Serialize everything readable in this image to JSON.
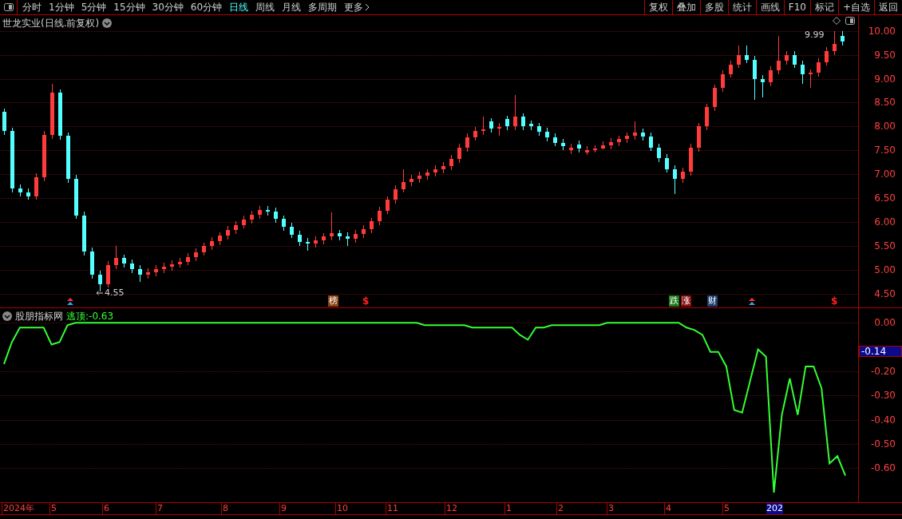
{
  "toolbar": {
    "periods": [
      {
        "label": "分时",
        "selected": false
      },
      {
        "label": "1分钟",
        "selected": false
      },
      {
        "label": "5分钟",
        "selected": false
      },
      {
        "label": "15分钟",
        "selected": false
      },
      {
        "label": "30分钟",
        "selected": false
      },
      {
        "label": "60分钟",
        "selected": false
      },
      {
        "label": "日线",
        "selected": true
      },
      {
        "label": "周线",
        "selected": false
      },
      {
        "label": "月线",
        "selected": false
      },
      {
        "label": "多周期",
        "selected": false
      }
    ],
    "more": "更多",
    "actions": [
      "复权",
      "叠加",
      "多股",
      "统计",
      "画线",
      "F10",
      "标记",
      "+自选",
      "返回"
    ]
  },
  "price_chart": {
    "title": "世龙实业(日线.前复权)",
    "high_label": "9.99",
    "low_label": "4.55",
    "markers": [
      {
        "kind": "arrow"
      },
      {
        "kind": "tag",
        "label": "榜",
        "color": "#8b4513"
      },
      {
        "kind": "dollar",
        "label": "$"
      },
      {
        "kind": "tag",
        "label": "跌",
        "color": "#1a7a1a"
      },
      {
        "kind": "tag",
        "label": "涨",
        "color": "#8b1010"
      },
      {
        "kind": "tag",
        "label": "财",
        "color": "#1c3f6e"
      },
      {
        "kind": "arrow"
      },
      {
        "kind": "dollar",
        "label": "$"
      }
    ],
    "chart_data": {
      "type": "candlestick",
      "categories": [
        null,
        null,
        null,
        null,
        null,
        null,
        null,
        null,
        null,
        null,
        null,
        null,
        null,
        null,
        null,
        null,
        null,
        null,
        null,
        null,
        null,
        null,
        null,
        null,
        null,
        null,
        null,
        null,
        null,
        null,
        null,
        null,
        null,
        null,
        null,
        null,
        null,
        null,
        null,
        null,
        null,
        null,
        null,
        null,
        null,
        null,
        null,
        null,
        null,
        null,
        null,
        null,
        null,
        null,
        null,
        null,
        null,
        null,
        null,
        null,
        null,
        null,
        null,
        null,
        null,
        null,
        null,
        null,
        null,
        null,
        null,
        null,
        null,
        null,
        null,
        null,
        null,
        null,
        null,
        null,
        null,
        null,
        null,
        null,
        null,
        null,
        null,
        null,
        null,
        null,
        null,
        null,
        null,
        null,
        null,
        null,
        null,
        null,
        null,
        null,
        null,
        null,
        null,
        null,
        null,
        null
      ],
      "ohlc": [
        [
          8.3,
          8.38,
          7.82,
          7.9
        ],
        [
          7.9,
          7.98,
          6.62,
          6.7
        ],
        [
          6.7,
          6.78,
          6.54,
          6.62
        ],
        [
          6.62,
          6.7,
          6.46,
          6.54
        ],
        [
          6.54,
          7.02,
          6.46,
          6.94
        ],
        [
          6.94,
          7.9,
          6.86,
          7.82
        ],
        [
          7.82,
          8.9,
          7.74,
          8.7
        ],
        [
          8.7,
          8.78,
          7.72,
          7.8
        ],
        [
          7.8,
          7.88,
          6.82,
          6.9
        ],
        [
          6.9,
          6.98,
          6.06,
          6.14
        ],
        [
          6.14,
          6.22,
          5.3,
          5.38
        ],
        [
          5.38,
          5.46,
          4.82,
          4.9
        ],
        [
          4.9,
          4.98,
          4.55,
          4.7
        ],
        [
          4.7,
          5.18,
          4.62,
          5.1
        ],
        [
          5.1,
          5.5,
          5.02,
          5.24
        ],
        [
          5.24,
          5.32,
          5.05,
          5.13
        ],
        [
          5.13,
          5.21,
          4.93,
          5.01
        ],
        [
          5.01,
          5.09,
          4.75,
          4.9
        ],
        [
          4.9,
          5.03,
          4.82,
          4.95
        ],
        [
          4.95,
          5.09,
          4.87,
          5.01
        ],
        [
          5.01,
          5.14,
          4.93,
          5.06
        ],
        [
          5.06,
          5.2,
          4.98,
          5.12
        ],
        [
          5.12,
          5.25,
          5.04,
          5.17
        ],
        [
          5.17,
          5.34,
          5.09,
          5.26
        ],
        [
          5.26,
          5.45,
          5.18,
          5.37
        ],
        [
          5.37,
          5.57,
          5.29,
          5.49
        ],
        [
          5.49,
          5.68,
          5.41,
          5.6
        ],
        [
          5.6,
          5.79,
          5.52,
          5.71
        ],
        [
          5.71,
          5.91,
          5.63,
          5.83
        ],
        [
          5.83,
          6.02,
          5.75,
          5.94
        ],
        [
          5.94,
          6.13,
          5.86,
          6.05
        ],
        [
          6.05,
          6.23,
          5.97,
          6.15
        ],
        [
          6.15,
          6.33,
          6.07,
          6.25
        ],
        [
          6.25,
          6.33,
          6.14,
          6.22
        ],
        [
          6.22,
          6.3,
          5.98,
          6.06
        ],
        [
          6.06,
          6.14,
          5.82,
          5.9
        ],
        [
          5.9,
          5.98,
          5.66,
          5.74
        ],
        [
          5.74,
          5.82,
          5.5,
          5.58
        ],
        [
          5.58,
          5.66,
          5.4,
          5.54
        ],
        [
          5.54,
          5.69,
          5.46,
          5.61
        ],
        [
          5.61,
          5.77,
          5.53,
          5.69
        ],
        [
          5.69,
          6.2,
          5.61,
          5.76
        ],
        [
          5.76,
          5.84,
          5.62,
          5.7
        ],
        [
          5.7,
          5.78,
          5.5,
          5.65
        ],
        [
          5.65,
          5.83,
          5.57,
          5.75
        ],
        [
          5.75,
          5.93,
          5.67,
          5.85
        ],
        [
          5.85,
          6.09,
          5.77,
          6.01
        ],
        [
          6.01,
          6.32,
          5.93,
          6.24
        ],
        [
          6.24,
          6.54,
          6.16,
          6.46
        ],
        [
          6.46,
          6.77,
          6.38,
          6.69
        ],
        [
          6.69,
          7.1,
          6.61,
          6.83
        ],
        [
          6.83,
          6.98,
          6.75,
          6.9
        ],
        [
          6.9,
          7.05,
          6.82,
          6.97
        ],
        [
          6.97,
          7.11,
          6.89,
          7.03
        ],
        [
          7.03,
          7.18,
          6.95,
          7.1
        ],
        [
          7.1,
          7.25,
          7.02,
          7.17
        ],
        [
          7.17,
          7.4,
          7.09,
          7.32
        ],
        [
          7.32,
          7.63,
          7.24,
          7.55
        ],
        [
          7.55,
          7.86,
          7.47,
          7.78
        ],
        [
          7.78,
          7.99,
          7.7,
          7.91
        ],
        [
          7.91,
          8.2,
          7.83,
          7.94
        ],
        [
          8.1,
          8.18,
          7.88,
          7.96
        ],
        [
          7.96,
          8.07,
          7.8,
          7.99
        ],
        [
          8.15,
          8.23,
          7.92,
          8.0
        ],
        [
          8.0,
          8.65,
          7.92,
          8.2
        ],
        [
          8.2,
          8.28,
          7.92,
          8.0
        ],
        [
          8.05,
          8.13,
          7.92,
          8.0
        ],
        [
          8.0,
          8.08,
          7.81,
          7.89
        ],
        [
          7.89,
          7.97,
          7.69,
          7.77
        ],
        [
          7.77,
          7.85,
          7.58,
          7.66
        ],
        [
          7.66,
          7.74,
          7.51,
          7.59
        ],
        [
          7.5,
          7.64,
          7.42,
          7.56
        ],
        [
          7.62,
          7.7,
          7.46,
          7.54
        ],
        [
          7.45,
          7.59,
          7.4,
          7.51
        ],
        [
          7.51,
          7.61,
          7.45,
          7.53
        ],
        [
          7.53,
          7.68,
          7.52,
          7.6
        ],
        [
          7.6,
          7.75,
          7.52,
          7.67
        ],
        [
          7.67,
          7.81,
          7.59,
          7.73
        ],
        [
          7.73,
          7.88,
          7.65,
          7.8
        ],
        [
          7.8,
          8.1,
          7.72,
          7.87
        ],
        [
          7.87,
          7.95,
          7.71,
          7.79
        ],
        [
          7.79,
          7.87,
          7.48,
          7.56
        ],
        [
          7.56,
          7.64,
          7.26,
          7.34
        ],
        [
          7.34,
          7.42,
          7.03,
          7.11
        ],
        [
          7.11,
          7.19,
          6.58,
          6.9
        ],
        [
          6.9,
          7.13,
          6.82,
          7.05
        ],
        [
          7.05,
          7.63,
          6.97,
          7.55
        ],
        [
          7.55,
          8.08,
          7.47,
          8.0
        ],
        [
          8.0,
          8.48,
          7.92,
          8.4
        ],
        [
          8.4,
          8.88,
          8.32,
          8.8
        ],
        [
          8.8,
          9.18,
          8.72,
          9.1
        ],
        [
          9.1,
          9.38,
          9.02,
          9.3
        ],
        [
          9.3,
          9.7,
          9.22,
          9.5
        ],
        [
          9.5,
          9.7,
          9.32,
          9.4
        ],
        [
          9.4,
          9.48,
          8.55,
          9.0
        ],
        [
          9.0,
          9.08,
          8.6,
          8.93
        ],
        [
          8.93,
          9.26,
          8.85,
          9.18
        ],
        [
          9.18,
          9.9,
          9.1,
          9.37
        ],
        [
          9.37,
          9.58,
          9.29,
          9.5
        ],
        [
          9.5,
          9.58,
          9.22,
          9.3
        ],
        [
          9.3,
          9.38,
          8.9,
          9.1
        ],
        [
          9.1,
          9.2,
          8.8,
          9.12
        ],
        [
          9.12,
          9.43,
          9.04,
          9.35
        ],
        [
          9.35,
          9.66,
          9.27,
          9.58
        ],
        [
          9.58,
          9.99,
          9.5,
          9.72
        ],
        [
          9.9,
          9.99,
          9.7,
          9.77
        ]
      ],
      "ylim": [
        4.21,
        10.33
      ],
      "grid": true,
      "yticks": [
        {
          "value": 10,
          "label": "10.00"
        },
        {
          "value": 9.5,
          "label": "9.50"
        },
        {
          "value": 9,
          "label": "9.00"
        },
        {
          "value": 8.5,
          "label": "8.50"
        },
        {
          "value": 8,
          "label": "8.00"
        },
        {
          "value": 7.5,
          "label": "7.50"
        },
        {
          "value": 7,
          "label": "7.00"
        },
        {
          "value": 6.5,
          "label": "6.50"
        },
        {
          "value": 6,
          "label": "6.00"
        },
        {
          "value": 5.5,
          "label": "5.50"
        },
        {
          "value": 5,
          "label": "5.00"
        },
        {
          "value": 4.5,
          "label": "4.50"
        }
      ]
    }
  },
  "indicator": {
    "name": "股朋指标网",
    "series_value": "-0.63",
    "current_value": "-0.14",
    "chart_data": {
      "type": "line",
      "categories": [
        null,
        null,
        null,
        null,
        null,
        null,
        null,
        null,
        null,
        null,
        null,
        null,
        null,
        null,
        null,
        null,
        null,
        null,
        null,
        null,
        null,
        null,
        null,
        null,
        null,
        null,
        null,
        null,
        null,
        null,
        null,
        null,
        null,
        null,
        null,
        null,
        null,
        null,
        null,
        null,
        null,
        null,
        null,
        null,
        null,
        null,
        null,
        null,
        null,
        null,
        null,
        null,
        null,
        null,
        null,
        null,
        null,
        null,
        null,
        null,
        null,
        null,
        null,
        null,
        null,
        null,
        null,
        null,
        null,
        null,
        null,
        null,
        null,
        null,
        null,
        null,
        null,
        null,
        null,
        null,
        null,
        null,
        null,
        null,
        null,
        null,
        null,
        null,
        null,
        null,
        null,
        null,
        null,
        null,
        null,
        null,
        null,
        null,
        null,
        null,
        null,
        null,
        null,
        null,
        null,
        null,
        null
      ],
      "series": [
        {
          "name": "逃顶:",
          "color": "#33ff33",
          "values": [
            -0.17,
            -0.08,
            -0.02,
            -0.02,
            -0.02,
            -0.02,
            -0.09,
            -0.08,
            -0.01,
            0,
            0,
            0,
            0,
            0,
            0,
            0,
            0,
            0,
            0,
            0,
            0,
            0,
            0,
            0,
            0,
            0,
            0,
            0,
            0,
            0,
            0,
            0,
            0,
            0,
            0,
            0,
            0,
            0,
            0,
            0,
            0,
            0,
            0,
            0,
            0,
            0,
            0,
            0,
            0,
            0,
            0,
            0,
            0,
            -0.01,
            -0.01,
            -0.01,
            -0.01,
            -0.01,
            -0.01,
            -0.02,
            -0.02,
            -0.02,
            -0.02,
            -0.02,
            -0.02,
            -0.05,
            -0.07,
            -0.02,
            -0.02,
            -0.01,
            -0.01,
            -0.01,
            -0.01,
            -0.01,
            -0.01,
            -0.01,
            0,
            0,
            0,
            0,
            0,
            0,
            0,
            0,
            0,
            0,
            -0.02,
            -0.03,
            -0.05,
            -0.12,
            -0.12,
            -0.18,
            -0.36,
            -0.37,
            -0.24,
            -0.11,
            -0.14,
            -0.7,
            -0.38,
            -0.23,
            -0.38,
            -0.18,
            -0.18,
            -0.27,
            -0.58,
            -0.55,
            -0.63
          ]
        }
      ],
      "ylim": [
        -0.74,
        0.06
      ],
      "grid": true,
      "yticks": [
        {
          "value": 0,
          "label": "0.00"
        },
        {
          "value": -0.2,
          "label": "-0.20"
        },
        {
          "value": -0.3,
          "label": "-0.30"
        },
        {
          "value": -0.4,
          "label": "-0.40"
        },
        {
          "value": -0.5,
          "label": "-0.50"
        },
        {
          "value": -0.6,
          "label": "-0.60"
        }
      ]
    }
  },
  "date_axis": [
    "2024年",
    "5",
    "6",
    "7",
    "8",
    "9",
    "10",
    "11",
    "12",
    "1",
    "2",
    "3",
    "4",
    "5",
    "202"
  ]
}
